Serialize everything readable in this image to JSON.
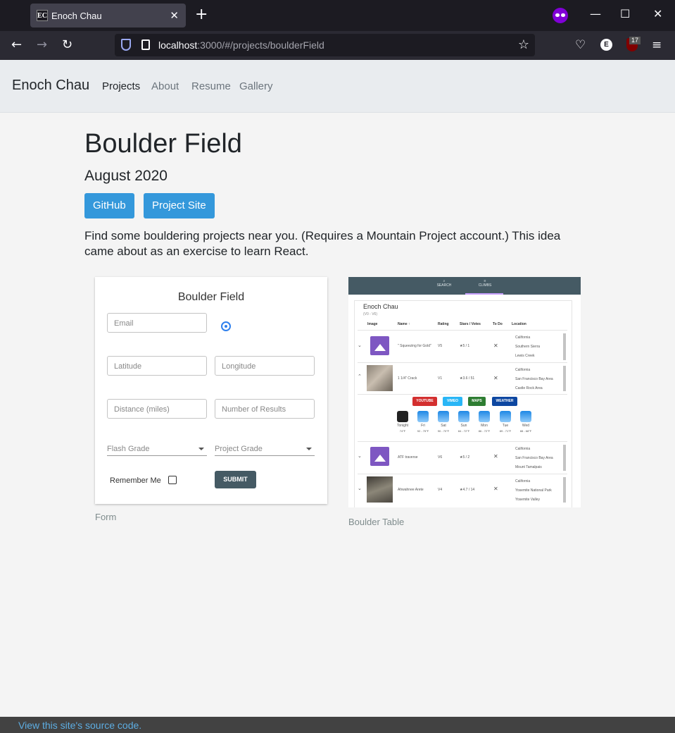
{
  "browser": {
    "tab_favicon": "EC",
    "tab_title": "Enoch Chau",
    "tab_close": "✕",
    "new_tab": "+",
    "window_min": "—",
    "window_max": "☐",
    "window_close": "✕",
    "back": "←",
    "forward": "→",
    "reload": "↻",
    "url_host": "localhost",
    "url_rest": ":3000/#/projects/boulderField",
    "bookmark_star": "☆",
    "pocket": "♡",
    "ext_account": "E",
    "ublock_badge": "17",
    "menu": "≡",
    "icons": [
      "shield-icon",
      "page-icon",
      "star-icon",
      "pocket-icon",
      "account-icon",
      "ublock-icon",
      "menu-icon",
      "private-mode-icon"
    ]
  },
  "site_nav": {
    "brand": "Enoch Chau",
    "links": [
      {
        "label": "Projects",
        "active": true
      },
      {
        "label": "About",
        "active": false
      },
      {
        "label": "Resume",
        "active": false
      },
      {
        "label": "Gallery",
        "active": false
      }
    ]
  },
  "project": {
    "title": "Boulder Field",
    "date": "August 2020",
    "buttons": [
      "GitHub",
      "Project Site"
    ],
    "description": "Find some bouldering projects near you. (Requires a Mountain Project account.) This idea came about as an exercise to learn React."
  },
  "form_screenshot": {
    "title": "Boulder Field",
    "email": "Email",
    "latitude": "Latitude",
    "longitude": "Longitude",
    "distance": "Distance (miles)",
    "num_results": "Number of Results",
    "flash_grade": "Flash Grade",
    "project_grade": "Project Grade",
    "remember": "Remember Me",
    "submit": "SUBMIT",
    "caption": "Form"
  },
  "table_screenshot": {
    "tabs": [
      "SEARCH",
      "CLIMBS"
    ],
    "title": "Enoch Chau",
    "subtitle": "(V0 - V6)",
    "headers": [
      "Image",
      "Name ↑",
      "Rating",
      "Stars / Votes",
      "To Do",
      "Location"
    ],
    "rows": [
      {
        "name": "\" Squeezing for Gold\"",
        "rating": "V5",
        "stars": "★5 / 1",
        "todo": "✕",
        "loc": [
          "California",
          "Southern Sierra",
          "Lewis Creek"
        ]
      },
      {
        "name": "1 1/4\" Crack",
        "rating": "V1",
        "stars": "★3.6 / 51",
        "todo": "✕",
        "loc": [
          "California",
          "San Francisco Bay Area",
          "Castle Rock Area"
        ]
      },
      {
        "name": "ATF traverse",
        "rating": "V6",
        "stars": "★5 / 2",
        "todo": "✕",
        "loc": [
          "California",
          "San Francisco Bay Area",
          "Mount Tamalpais"
        ]
      },
      {
        "name": "Ahwahnee Arete",
        "rating": "V4",
        "stars": "★4.7 / 14",
        "todo": "✕",
        "loc": [
          "California",
          "Yosemite National Park",
          "Yosemite Valley"
        ]
      }
    ],
    "chips": [
      {
        "label": "YOUTUBE",
        "color": "#d32f2f"
      },
      {
        "label": "VIMEO",
        "color": "#29b6f6"
      },
      {
        "label": "MAPS",
        "color": "#2e7d32"
      },
      {
        "label": "WEATHER",
        "color": "#0d47a1"
      }
    ],
    "weather": [
      {
        "day": "Tonight",
        "temp": "74°F"
      },
      {
        "day": "Fri",
        "temp": "92 - 75°F"
      },
      {
        "day": "Sat",
        "temp": "90 - 70°F"
      },
      {
        "day": "Sun",
        "temp": "84 - 72°F"
      },
      {
        "day": "Mon",
        "temp": "86 - 72°F"
      },
      {
        "day": "Tue",
        "temp": "89 - 71°F"
      },
      {
        "day": "Wed",
        "temp": "88 - 68°F"
      }
    ],
    "caption": "Boulder Table"
  },
  "footer": {
    "link": "View this site's source code."
  },
  "colors": {
    "accent": "#3498db",
    "page_bg": "#f4f4f4",
    "nav_bg": "#e9ecef",
    "footer_bg": "#424242",
    "footer_link": "#5dade2"
  }
}
